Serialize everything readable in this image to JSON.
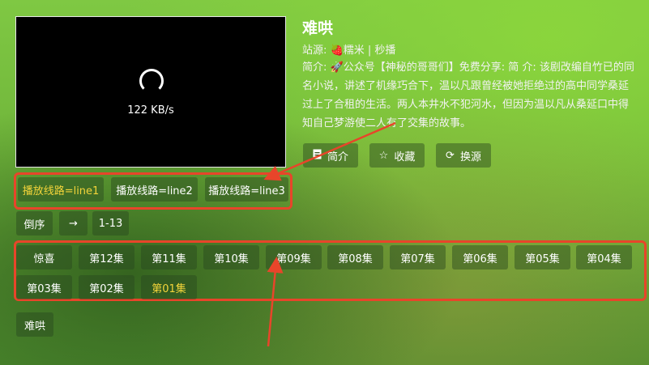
{
  "player": {
    "speed": "122 KB/s"
  },
  "info": {
    "title": "难哄",
    "site": "站源: 🍓糯米 | 秒播",
    "desc": "简介: 🚀公众号【神秘的哥哥们】免费分享: 简 介: 该剧改编自竹已的同名小说，讲述了机缘巧合下，温以凡跟曾经被她拒绝过的高中同学桑延过上了合租的生活。两人本井水不犯河水，但因为温以凡从桑延口中得知自己梦游使二人有了交集的故事。"
  },
  "actions": {
    "intro": {
      "label": "简介",
      "icon": "document-icon"
    },
    "favorite": {
      "label": "收藏",
      "icon": "star-icon"
    },
    "source": {
      "label": "换源",
      "icon": "refresh-icon"
    }
  },
  "lines": [
    "播放线路=line1",
    "播放线路=line2",
    "播放线路=line3"
  ],
  "controls": {
    "order": "倒序",
    "arrow": "→",
    "range": "1-13"
  },
  "episodes": [
    "惊喜",
    "第12集",
    "第11集",
    "第10集",
    "第09集",
    "第08集",
    "第07集",
    "第06集",
    "第05集",
    "第04集",
    "第03集",
    "第02集",
    "第01集"
  ],
  "tag": "难哄",
  "colors": {
    "active": "#f3d43a",
    "annotation": "#e8452a"
  }
}
